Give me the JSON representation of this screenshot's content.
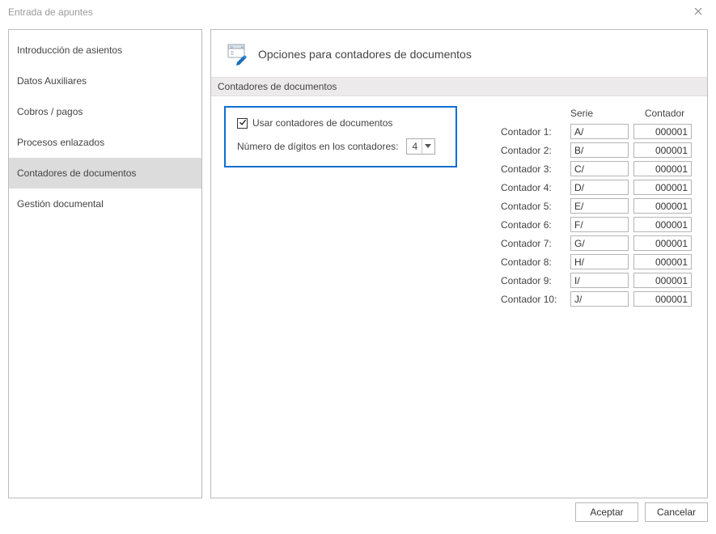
{
  "window": {
    "title": "Entrada de apuntes"
  },
  "sidebar": {
    "items": [
      {
        "label": "Introducción de asientos",
        "selected": false
      },
      {
        "label": "Datos Auxiliares",
        "selected": false
      },
      {
        "label": "Cobros / pagos",
        "selected": false
      },
      {
        "label": "Procesos enlazados",
        "selected": false
      },
      {
        "label": "Contadores de documentos",
        "selected": true
      },
      {
        "label": "Gestión documental",
        "selected": false
      }
    ]
  },
  "main": {
    "heading": "Opciones para contadores de documentos",
    "section_label": "Contadores de documentos",
    "option_box": {
      "use_counters_label": "Usar contadores de documentos",
      "use_counters_checked": true,
      "digits_label": "Número de dígitos en los contadores:",
      "digits_value": "4"
    },
    "counters_table": {
      "header_serie": "Serie",
      "header_contador": "Contador",
      "row_label_prefix": "Contador",
      "rows": [
        {
          "n": "1",
          "serie": "A/",
          "contador": "000001"
        },
        {
          "n": "2",
          "serie": "B/",
          "contador": "000001"
        },
        {
          "n": "3",
          "serie": "C/",
          "contador": "000001"
        },
        {
          "n": "4",
          "serie": "D/",
          "contador": "000001"
        },
        {
          "n": "5",
          "serie": "E/",
          "contador": "000001"
        },
        {
          "n": "6",
          "serie": "F/",
          "contador": "000001"
        },
        {
          "n": "7",
          "serie": "G/",
          "contador": "000001"
        },
        {
          "n": "8",
          "serie": "H/",
          "contador": "000001"
        },
        {
          "n": "9",
          "serie": "I/",
          "contador": "000001"
        },
        {
          "n": "10",
          "serie": "J/",
          "contador": "000001"
        }
      ]
    }
  },
  "footer": {
    "accept_label": "Aceptar",
    "cancel_label": "Cancelar"
  }
}
